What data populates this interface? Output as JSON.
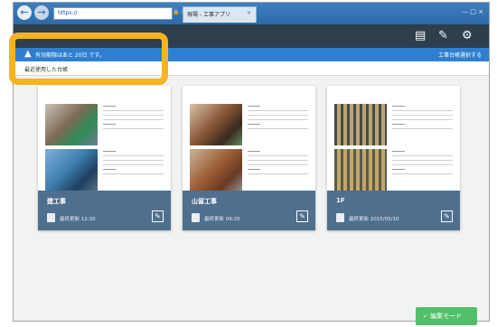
{
  "browser": {
    "address": "https://",
    "tab_title": "現場 - 工事アプリ",
    "tab_close": "×",
    "window_controls": "— □ ×",
    "addr_tools": "🔒 ✕ ★"
  },
  "toolbar": {
    "back": "←",
    "forward": "→",
    "icons": [
      "book-icon",
      "user-check-icon",
      "gear-icon"
    ]
  },
  "notice": {
    "text": "有効期限はあと 20日 です。",
    "mode_link": "工事台帳選択する",
    "highlight_color": "#f6b51f"
  },
  "strip": {
    "label": "最近使用した台帳"
  },
  "cards": [
    {
      "title": "建工事",
      "updated": "最終更新 12:30",
      "photo_colors": [
        "#7d6a55",
        "#3f7fb0"
      ]
    },
    {
      "title": "山留工事",
      "updated": "最終更新 09:20",
      "photo_colors": [
        "#8a5a3a",
        "#a0603a"
      ]
    },
    {
      "title": "1F",
      "updated": "最終更新 2015/05/10",
      "photo_colors": [
        "#6f6a55",
        "#8a7a4a"
      ]
    }
  ],
  "new_button": {
    "label": "✓ 編集モード"
  }
}
